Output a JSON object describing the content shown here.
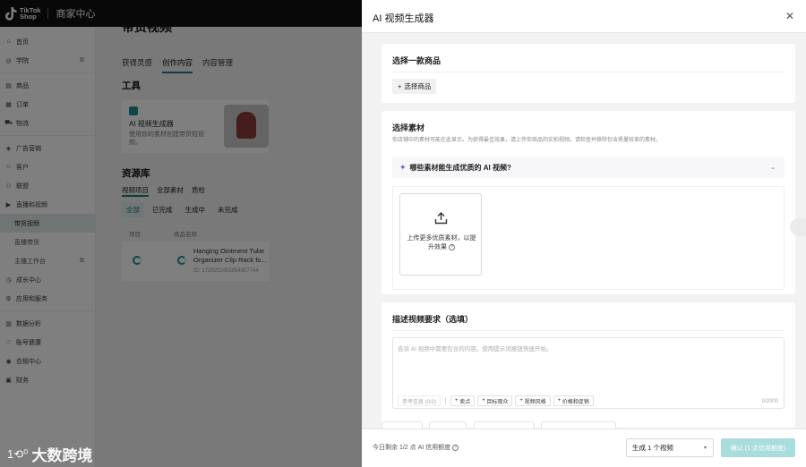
{
  "topbar": {
    "brand_line1": "TikTok",
    "brand_line2": "Shop",
    "title": "商家中心"
  },
  "sidebar": {
    "items": [
      {
        "label": "首页",
        "icon": "home-icon"
      },
      {
        "label": "学院",
        "icon": "academy-icon",
        "external": true
      },
      {
        "sep": true
      },
      {
        "label": "商品",
        "icon": "product-icon"
      },
      {
        "label": "订单",
        "icon": "order-icon"
      },
      {
        "label": "物流",
        "icon": "truck-icon"
      },
      {
        "sep": true
      },
      {
        "label": "广告营销",
        "icon": "megaphone-icon"
      },
      {
        "label": "客户",
        "icon": "customer-icon"
      },
      {
        "label": "联盟",
        "icon": "affiliate-icon"
      },
      {
        "label": "直播和视频",
        "icon": "video-icon"
      },
      {
        "label": "带货视频",
        "sub": true,
        "active": true
      },
      {
        "label": "直播带货",
        "sub": true
      },
      {
        "label": "主播工作台",
        "sub": true,
        "external": true
      },
      {
        "label": "成长中心",
        "icon": "growth-icon"
      },
      {
        "label": "应用和服务",
        "icon": "apps-icon"
      },
      {
        "sep": true
      },
      {
        "label": "数据分析",
        "icon": "analytics-icon"
      },
      {
        "label": "账号健康",
        "icon": "health-icon"
      },
      {
        "label": "合规中心",
        "icon": "compliance-icon"
      },
      {
        "label": "财务",
        "icon": "finance-icon"
      }
    ]
  },
  "main": {
    "title": "带货视频",
    "tabs": [
      "获得灵感",
      "创作内容",
      "内容管理"
    ],
    "tools_heading": "工具",
    "tool_name": "AI 视频生成器",
    "tool_desc": "使用你的素材创建带货短视频。",
    "library_heading": "资源库",
    "sub_tabs": [
      "视频项目",
      "全部素材",
      "质检"
    ],
    "filters": [
      "全部",
      "已完成",
      "生成中",
      "未完成"
    ],
    "col_project": "项目",
    "col_product": "商品名称",
    "product_title": "Hanging Ointment Tube Organizer Clip Rack fo...",
    "product_id": "ID: 1729252455954907744"
  },
  "watermark": {
    "mark": "1⟲⁰",
    "text": "大数跨境"
  },
  "drawer": {
    "title": "AI 视频生成器",
    "section1_title": "选择一款商品",
    "select_product_btn": "选择商品",
    "section2_title": "选择素材",
    "section2_hint": "你店铺中的素材可能在此显示。为获得最佳效果，请上传你商品的实拍视频。请检查并移除包含质量较差的素材。",
    "collapse_label": "哪些素材能生成优质的 AI 视频?",
    "upload_text": "上传更多优质素材，以提升效果",
    "section3_title": "描述视频要求（选填）",
    "textarea_placeholder": "告诉 AI 视频中需要包含的内容。使用提示词按钮快速开始。",
    "chips": [
      "参考信息 (0/2)",
      "卖点",
      "目标观众",
      "视频风格",
      "价格和促销"
    ],
    "counter": "0/2000",
    "quota": "今日剩余 1/2 点 AI 信用额度",
    "count_select": "生成 1 个视频",
    "confirm_btn": "确认 (1 点信用额度)"
  }
}
